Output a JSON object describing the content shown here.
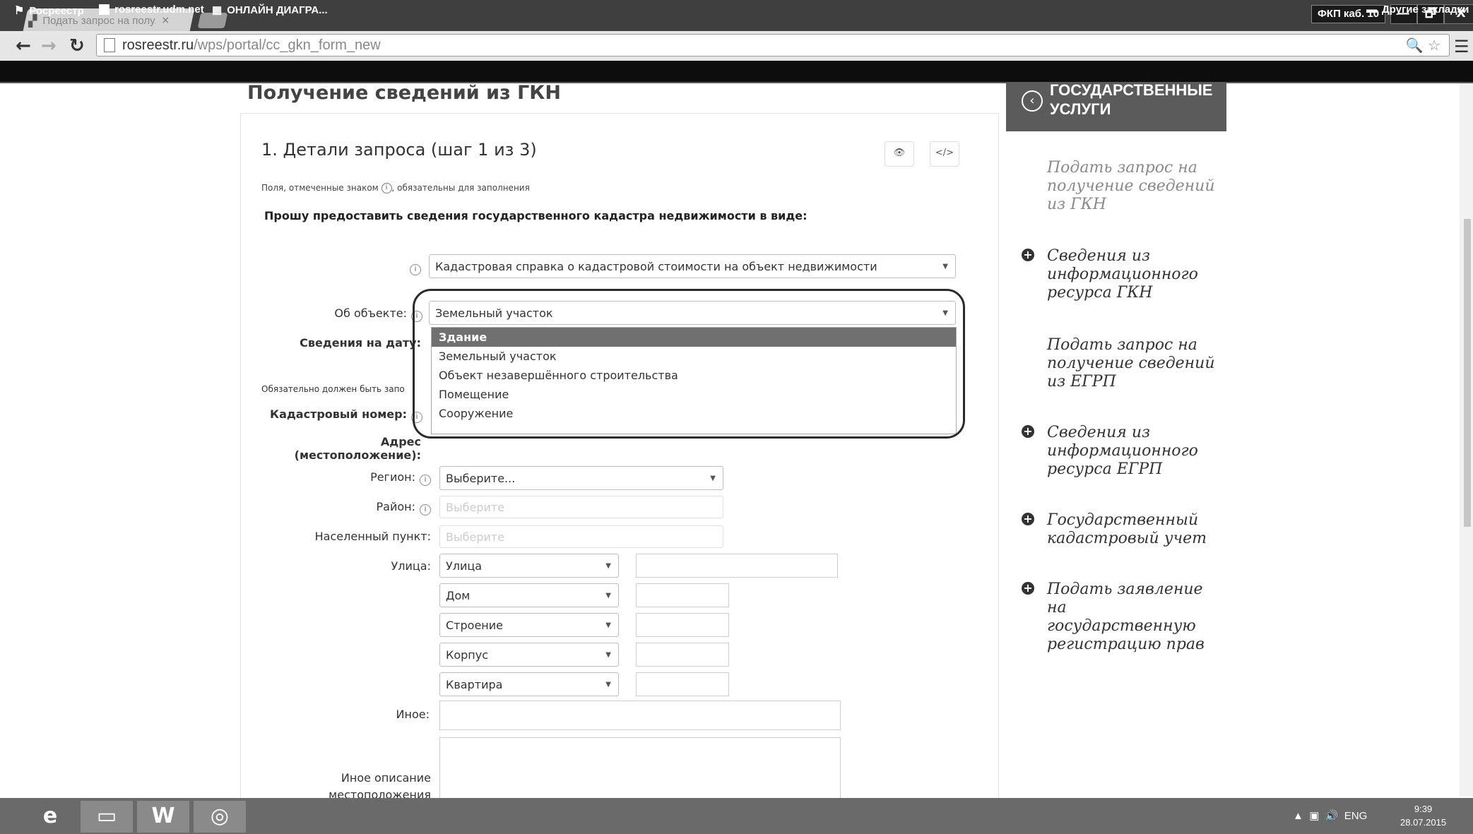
{
  "browser": {
    "tab_title": "Подать запрос на полу...",
    "tab_close": "×",
    "url_host": "rosreestr.ru",
    "url_path": "/wps/portal/cc_gkn_form_new",
    "window_user": "ФКП каб. 10",
    "win_minimize": "—",
    "win_restore": "🗗",
    "win_close": "X",
    "bookmarks": [
      "Росреестр",
      "rosreestr.udm.net",
      "ОНЛАЙН ДИАГРА..."
    ],
    "other_bookmarks": "Другие закладки"
  },
  "page": {
    "title": "Получение сведений из ГКН",
    "step_title": "1. Детали запроса (шаг 1 из 3)",
    "eye_icon": "👁",
    "code_icon": "</>",
    "required_hint_prefix": "Поля, отмеченные знаком",
    "required_hint_suffix": ", обязательны для заполнения",
    "required_mark": "i",
    "request_label": "Прошу предоставить сведения государственного кадастра недвижимости в виде:",
    "doc_type_value": "Кадастровая справка о кадастровой стоимости на объект недвижимости",
    "object_label": "Об объекте:",
    "object_value": "Земельный участок",
    "object_options": [
      "Здание",
      "Земельный участок",
      "Объект незавершённого строительства",
      "Помещение",
      "Сооружение"
    ],
    "date_label": "Сведения на дату:",
    "mandatory_note": "Обязательно должен быть запо",
    "cadastral_label": "Кадастровый номер:",
    "address_label": "Адрес (местоположение):",
    "region_label": "Регион:",
    "region_value": "Выберите...",
    "district_label": "Район:",
    "district_value": "Выберите",
    "locality_label": "Населенный пункт:",
    "locality_value": "Выберите",
    "street_label": "Улица:",
    "street_type": "Улица",
    "house_type": "Дом",
    "building_type": "Строение",
    "korpus_type": "Корпус",
    "apartment_type": "Квартира",
    "other_label": "Иное:",
    "other_desc_label_1": "Иное описание",
    "other_desc_label_2": "местоположения"
  },
  "sidebar": {
    "header": "ГОСУДАРСТВЕННЫЕ УСЛУГИ",
    "header_line1": "ГОСУДАРСТВЕННЫЕ",
    "header_line2": "УСЛУГИ",
    "links": [
      [
        "Подать запрос на",
        "получение сведений",
        "из ГКН"
      ],
      [
        "Сведения из",
        "информационного",
        "ресурса ГКН"
      ],
      [
        "Подать запрос на",
        "получение сведений",
        "из ЕГРП"
      ],
      [
        "Сведения из",
        "информационного",
        "ресурса ЕГРП"
      ],
      [
        "Государственный",
        "кадастровый учет"
      ],
      [
        "Подать заявление",
        "на",
        "государственную",
        "регистрацию прав"
      ]
    ]
  },
  "taskbar": {
    "lang": "ENG",
    "time": "9:39",
    "date": "28.07.2015"
  }
}
